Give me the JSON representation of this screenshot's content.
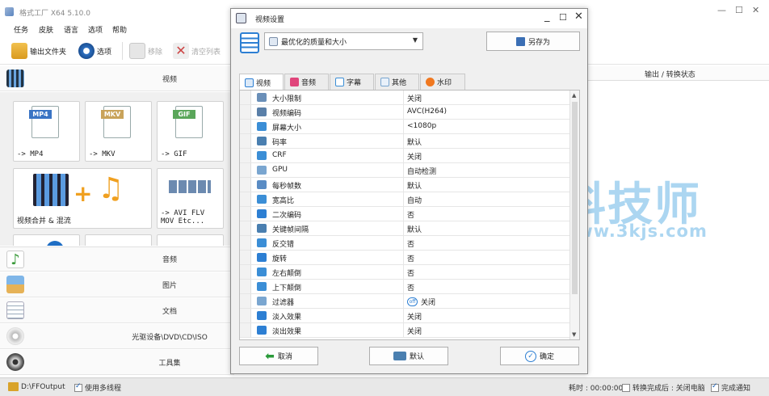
{
  "app": {
    "title": "格式工厂 X64 5.10.0",
    "menu": [
      "任务",
      "皮肤",
      "语言",
      "选项",
      "帮助"
    ],
    "toolbar": {
      "output_folder": "输出文件夹",
      "options": "选项",
      "remove": "移除",
      "clear_list": "清空列表"
    },
    "categories": {
      "video": "视频",
      "audio": "音频",
      "image": "图片",
      "document": "文档",
      "disc": "光驱设备\\DVD\\CD\\ISO",
      "tools": "工具集"
    },
    "video_tiles": {
      "mp4": {
        "tag": "MP4",
        "label": "-> MP4"
      },
      "mkv": {
        "tag": "MKV",
        "label": "-> MKV"
      },
      "gif": {
        "tag": "GIF",
        "label": "-> GIF"
      },
      "merge": {
        "label": "视频合并 & 混流"
      },
      "avi": {
        "label": "-> AVI FLV\nMOV Etc..."
      }
    },
    "right_header": "输出 / 转换状态",
    "status": {
      "output_path": "D:\\FFOutput",
      "multithread": "使用多线程",
      "elapsed": "耗时 : 00:00:00",
      "after_done": "转换完成后 : 关闭电脑",
      "notify": "完成通知"
    }
  },
  "dialog": {
    "title": "视频设置",
    "preset": "最优化的质量和大小",
    "save_as": "另存为",
    "tabs": [
      "视频",
      "音频",
      "字幕",
      "其他",
      "水印"
    ],
    "active_tab": "视频",
    "rows": [
      {
        "name": "大小限制",
        "value": "关闭",
        "icon": "size-limit-icon",
        "color": "#6a8fb8"
      },
      {
        "name": "视频编码",
        "value": "AVC(H264)",
        "icon": "codec-icon",
        "color": "#5a7fa8"
      },
      {
        "name": "屏幕大小",
        "value": "<1080p",
        "icon": "screen-icon",
        "color": "#3b8ed6"
      },
      {
        "name": "码率",
        "value": "默认",
        "icon": "bitrate-icon",
        "color": "#4a7fb0"
      },
      {
        "name": "CRF",
        "value": "关闭",
        "icon": "crf-icon",
        "color": "#3b8ed6"
      },
      {
        "name": "GPU",
        "value": "自动检测",
        "icon": "gpu-icon",
        "color": "#7aa6d0"
      },
      {
        "name": "每秒帧数",
        "value": "默认",
        "icon": "fps-icon",
        "color": "#5a8cc4"
      },
      {
        "name": "宽高比",
        "value": "自动",
        "icon": "aspect-icon",
        "color": "#3b8ed6"
      },
      {
        "name": "二次编码",
        "value": "否",
        "icon": "two-pass-icon",
        "color": "#2d7fd3"
      },
      {
        "name": "关键帧间隔",
        "value": "默认",
        "icon": "keyframe-icon",
        "color": "#4a7fb0"
      },
      {
        "name": "反交错",
        "value": "否",
        "icon": "deinterlace-icon",
        "color": "#3b8ed6"
      },
      {
        "name": "旋转",
        "value": "否",
        "icon": "rotate-icon",
        "color": "#2d7fd3"
      },
      {
        "name": "左右颠倒",
        "value": "否",
        "icon": "flip-h-icon",
        "color": "#3b8ed6"
      },
      {
        "name": "上下颠倒",
        "value": "否",
        "icon": "flip-v-icon",
        "color": "#3b8ed6"
      },
      {
        "name": "过滤器",
        "value": "关闭",
        "icon": "filter-icon",
        "color": "#7aa6d0",
        "badge": "off"
      },
      {
        "name": "淡入效果",
        "value": "关闭",
        "icon": "fade-in-icon",
        "color": "#2d7fd3"
      },
      {
        "name": "淡出效果",
        "value": "关闭",
        "icon": "fade-out-icon",
        "color": "#2d7fd3"
      }
    ],
    "buttons": {
      "cancel": "取消",
      "default": "默认",
      "ok": "确定"
    }
  },
  "watermark": {
    "text": "科技师",
    "url": "www.3kjs.com"
  },
  "colors": {
    "accent": "#2d7fd3",
    "watermark": "#9ed0ef"
  }
}
